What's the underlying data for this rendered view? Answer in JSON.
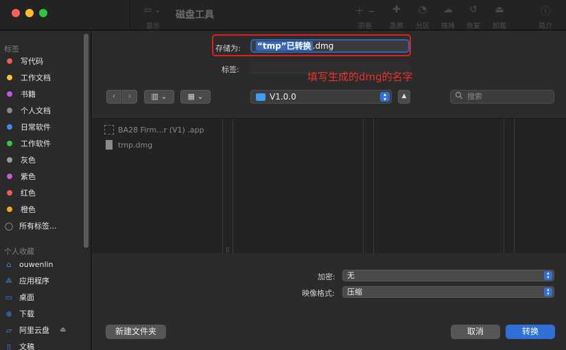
{
  "app": {
    "title": "磁盘工具"
  },
  "toolbar": {
    "view_label": "显示",
    "tools": [
      {
        "glyph": "＋ −",
        "label": "宗卷"
      },
      {
        "glyph": "✚",
        "label": "急救"
      },
      {
        "glyph": "◔",
        "label": "分区"
      },
      {
        "glyph": "☁",
        "label": "抹掉"
      },
      {
        "glyph": "↺",
        "label": "恢复"
      },
      {
        "glyph": "⏏",
        "label": "卸载"
      },
      {
        "glyph": "ⓘ",
        "label": "简介"
      }
    ]
  },
  "sidebar": {
    "tags_header": "标签",
    "tags": [
      {
        "label": "写代码",
        "color": "#f05a55"
      },
      {
        "label": "工作文档",
        "color": "#f7c435"
      },
      {
        "label": "书籍",
        "color": "#c45ad8"
      },
      {
        "label": "个人文档",
        "color": "#8a8a8a"
      },
      {
        "label": "日常软件",
        "color": "#3d8cf5"
      },
      {
        "label": "工作软件",
        "color": "#33c648"
      },
      {
        "label": "灰色",
        "color": "#9a9a9a"
      },
      {
        "label": "紫色",
        "color": "#c45ad8"
      },
      {
        "label": "红色",
        "color": "#f05a55"
      },
      {
        "label": "橙色",
        "color": "#f5a623"
      }
    ],
    "all_tags": "所有标签...",
    "favorites_header": "个人收藏",
    "favorites": [
      {
        "label": "ouwenlin",
        "icon": "home-icon"
      },
      {
        "label": "应用程序",
        "icon": "applications-icon"
      },
      {
        "label": "桌面",
        "icon": "desktop-icon"
      },
      {
        "label": "下载",
        "icon": "download-icon"
      },
      {
        "label": "阿里云盘",
        "icon": "cloud-drive-icon"
      },
      {
        "label": "文稿",
        "icon": "documents-icon"
      }
    ]
  },
  "save_dialog": {
    "save_as_label": "存储为:",
    "filename_selected": "“tmp”已转换",
    "filename_ext": ".dmg",
    "tags_label": "标签:",
    "annotation": "填写生成的dmg的名字",
    "location": "V1.0.0",
    "search_placeholder": "搜索",
    "files": [
      {
        "name": "BA28 Firm...r (V1) .app",
        "icon": "app-bundle-icon"
      },
      {
        "name": "tmp.dmg",
        "icon": "dmg-file-icon"
      }
    ],
    "encryption_label": "加密:",
    "encryption_value": "无",
    "image_format_label": "映像格式:",
    "image_format_value": "压缩",
    "new_folder_button": "新建文件夹",
    "cancel_button": "取消",
    "convert_button": "转换"
  },
  "colors": {
    "accent": "#2f6fd6",
    "annotation": "#e0201a"
  }
}
